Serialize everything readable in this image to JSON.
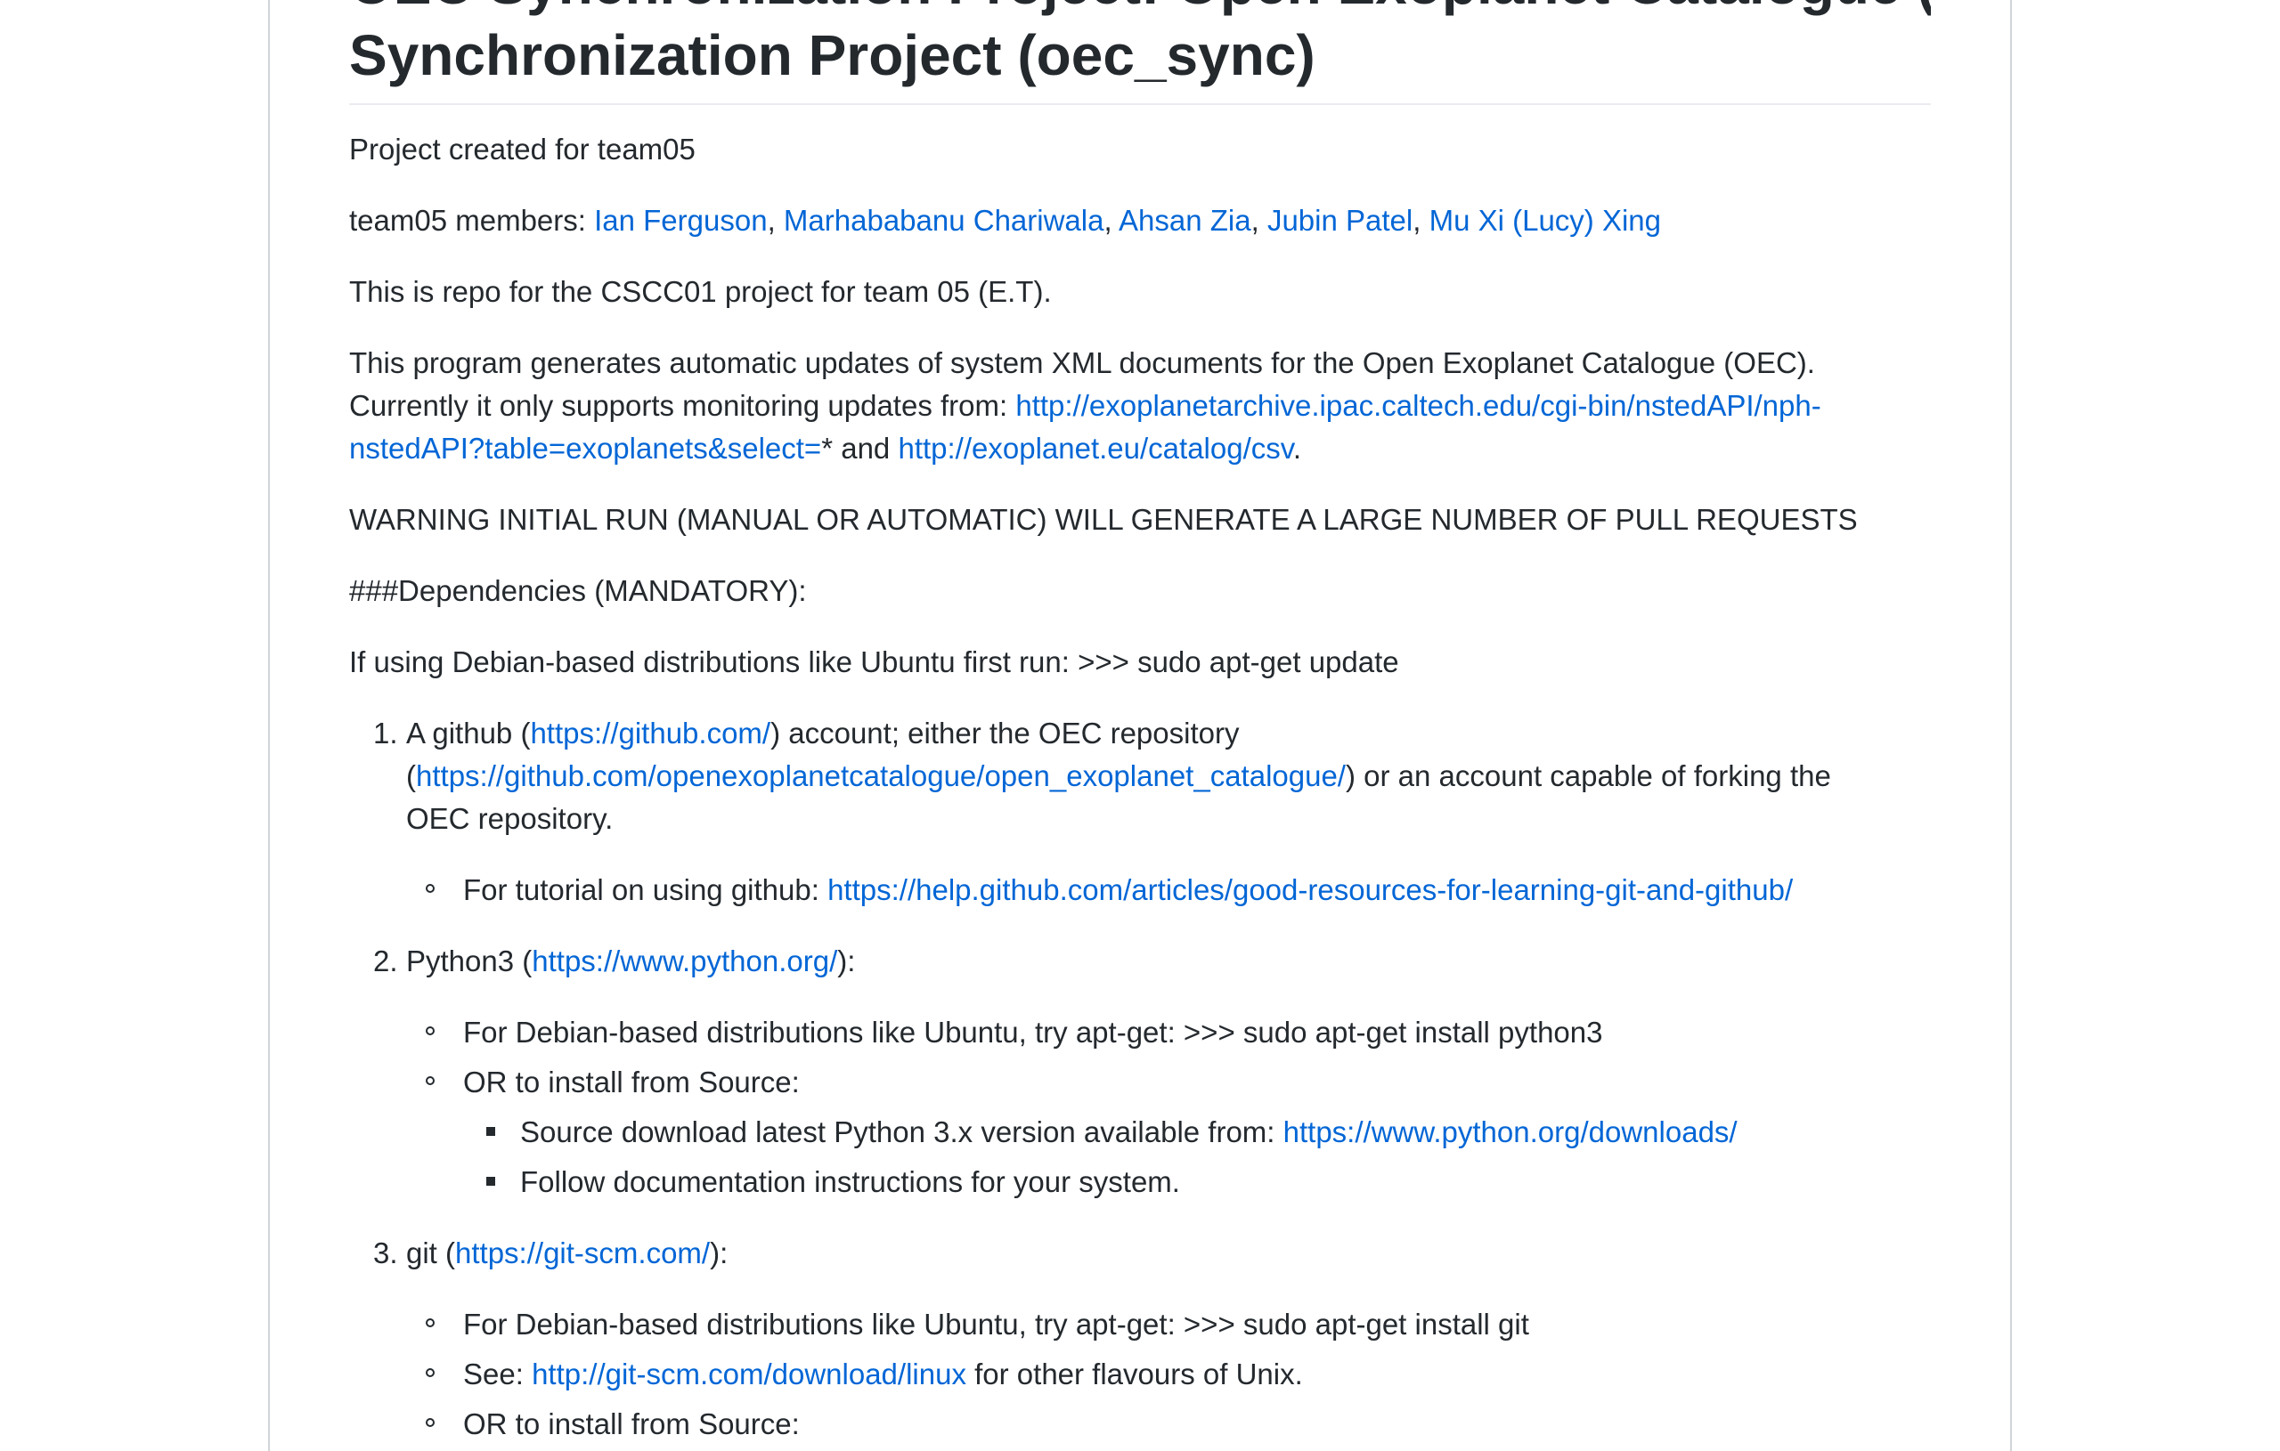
{
  "header": {
    "title_line1": "OEC Synchronization Project: Open Exoplanet Catalogue (OEC)",
    "title_line2": "Synchronization Project (oec_sync)"
  },
  "intro": {
    "created": "Project created for team05",
    "members_label": "team05 members: ",
    "members": [
      "Ian Ferguson",
      "Marhababanu Chariwala",
      "Ahsan Zia",
      "Jubin Patel",
      "Mu Xi (Lucy) Xing"
    ],
    "sep": ", ",
    "repo_line": "This is repo for the CSCC01 project for team 05 (E.T).",
    "program_line1": "This program generates automatic updates of system XML documents for the Open Exoplanet Catalogue (OEC).",
    "program_line2_prefix": "Currently it only supports monitoring updates from: ",
    "nasa_link_part1": "http://exoplanetarchive.ipac.caltech.edu/cgi-bin/nstedAPI/nph-",
    "nasa_link_part2": "nstedAPI?table=exoplanets&select=",
    "star_and": "* and ",
    "eu_link": "http://exoplanet.eu/catalog/csv",
    "period": ".",
    "warning": "WARNING INITIAL RUN (MANUAL OR AUTOMATIC) WILL GENERATE A LARGE NUMBER OF PULL REQUESTS",
    "dependencies": "###Dependencies (MANDATORY):",
    "debian_note": "If using Debian-based distributions like Ubuntu first run: >>> sudo apt-get update"
  },
  "list": {
    "item1": {
      "num": "1.",
      "prefix": "A github (",
      "github_link": "https://github.com/",
      "mid": ") account; either the OEC repository",
      "open_paren": "(",
      "oec_link": "https://github.com/openexoplanetcatalogue/open_exoplanet_catalogue/",
      "suffix": ") or an account capable of forking the",
      "line3": "OEC repository.",
      "sub1_prefix": "For tutorial on using github: ",
      "sub1_link": "https://help.github.com/articles/good-resources-for-learning-git-and-github/"
    },
    "item2": {
      "num": "2.",
      "prefix": "Python3 (",
      "link": "https://www.python.org/",
      "suffix": "):",
      "sub1": "For Debian-based distributions like Ubuntu, try apt-get: >>> sudo apt-get install python3",
      "sub2": "OR to install from Source:",
      "subsub1_prefix": "Source download latest Python 3.x version available from: ",
      "subsub1_link": "https://www.python.org/downloads/",
      "subsub2": "Follow documentation instructions for your system."
    },
    "item3": {
      "num": "3.",
      "prefix": "git (",
      "link": "https://git-scm.com/",
      "suffix": "):",
      "sub1": "For Debian-based distributions like Ubuntu, try apt-get: >>> sudo apt-get install git",
      "sub2_prefix": "See: ",
      "sub2_link": "http://git-scm.com/download/linux",
      "sub2_suffix": " for other flavours of Unix.",
      "sub3": "OR to install from Source:"
    }
  }
}
